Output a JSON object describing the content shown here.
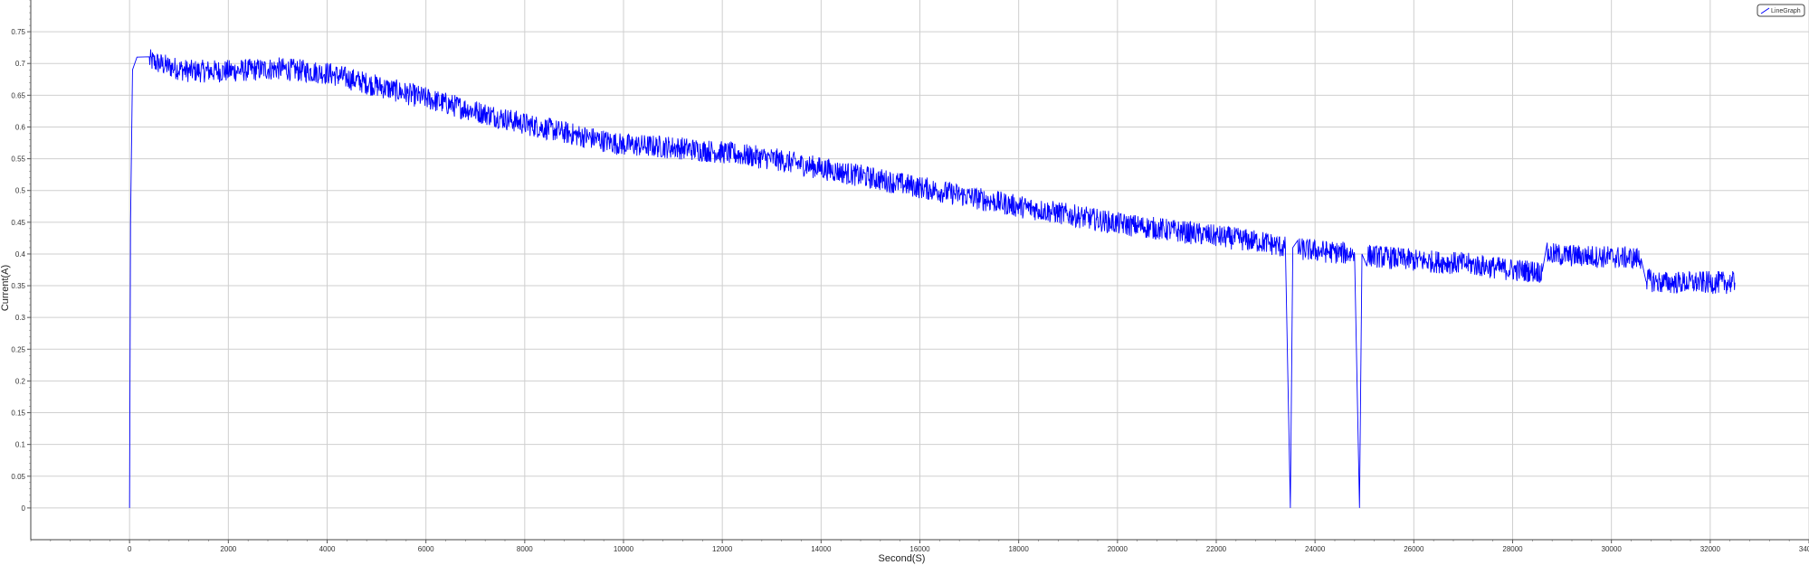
{
  "chart_data": {
    "type": "line",
    "title": "",
    "xlabel": "Second(S)",
    "ylabel": "Current(A)",
    "xlim": [
      -2000,
      34000
    ],
    "ylim": [
      -0.05,
      0.8
    ],
    "x_ticks": [
      0,
      2000,
      4000,
      6000,
      8000,
      10000,
      12000,
      14000,
      16000,
      18000,
      20000,
      22000,
      24000,
      26000,
      28000,
      30000,
      32000,
      34000
    ],
    "y_ticks": [
      0,
      0.05,
      0.1,
      0.15,
      0.2,
      0.25,
      0.3,
      0.35,
      0.4,
      0.45,
      0.5,
      0.55,
      0.6,
      0.65,
      0.7,
      0.75
    ],
    "grid": true,
    "legend": "top-right",
    "series": [
      {
        "name": "LineGraph",
        "color": "#0000ff",
        "x": [
          0,
          20,
          60,
          150,
          400,
          800,
          1200,
          2000,
          3000,
          4000,
          5000,
          6000,
          7000,
          8000,
          9000,
          10000,
          11000,
          12000,
          13000,
          14000,
          15000,
          16000,
          17000,
          18000,
          19000,
          20000,
          21000,
          22000,
          23000,
          23400,
          23500,
          23550,
          23650,
          24000,
          24800,
          24900,
          24950,
          25050,
          26000,
          27000,
          28000,
          28600,
          28700,
          29000,
          30000,
          30600,
          30700,
          31000,
          32000,
          32500
        ],
        "y": [
          0,
          0.45,
          0.69,
          0.71,
          0.705,
          0.695,
          0.688,
          0.688,
          0.692,
          0.685,
          0.665,
          0.645,
          0.625,
          0.605,
          0.588,
          0.572,
          0.568,
          0.56,
          0.55,
          0.535,
          0.52,
          0.505,
          0.49,
          0.475,
          0.462,
          0.448,
          0.438,
          0.428,
          0.418,
          0.41,
          0.0,
          0.41,
          0.408,
          0.405,
          0.4,
          0.0,
          0.4,
          0.398,
          0.39,
          0.385,
          0.375,
          0.372,
          0.4,
          0.398,
          0.395,
          0.393,
          0.36,
          0.355,
          0.355,
          0.355
        ],
        "noise": 0.018
      }
    ]
  }
}
